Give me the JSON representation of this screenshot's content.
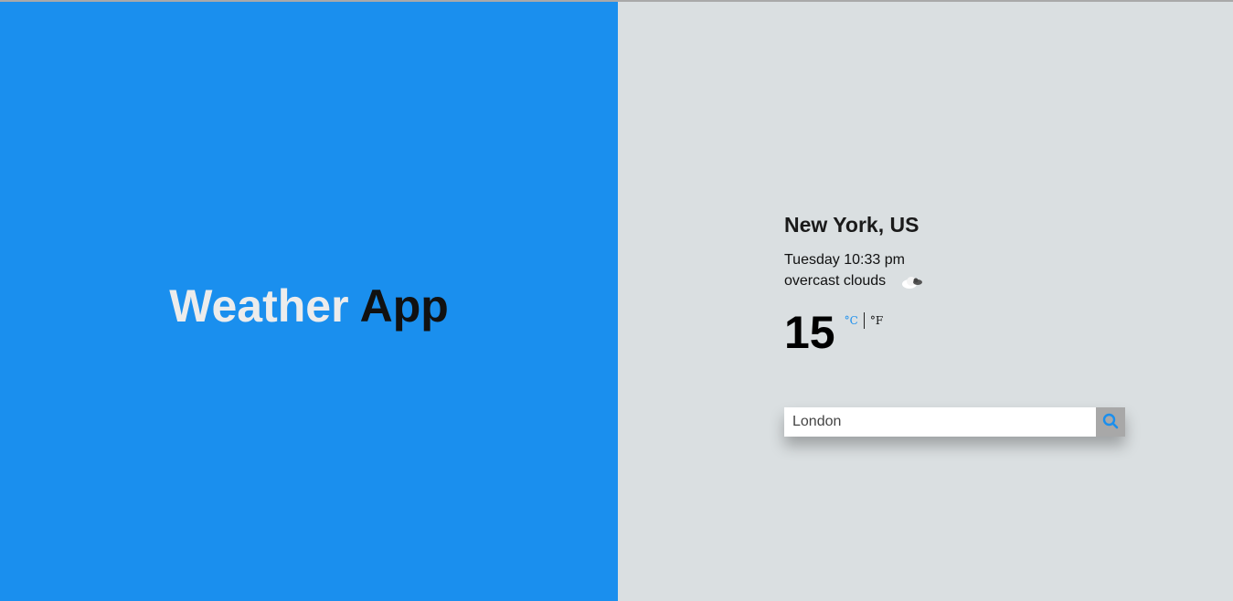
{
  "hero": {
    "title_part1": "Weather",
    "title_part2": "App"
  },
  "weather": {
    "location": "New York, US",
    "datetime": "Tuesday 10:33 pm",
    "description": "overcast clouds",
    "icon": "overcast-clouds-icon",
    "temperature": "15",
    "unit_celsius": "°C",
    "unit_fahrenheit": "°F",
    "active_unit": "celsius"
  },
  "search": {
    "value": "London",
    "placeholder": "",
    "button_icon": "search-icon"
  },
  "colors": {
    "left_panel": "#1a8fee",
    "right_panel": "#dadfe1",
    "accent": "#1a8fee",
    "search_button": "#a8a8a8"
  }
}
